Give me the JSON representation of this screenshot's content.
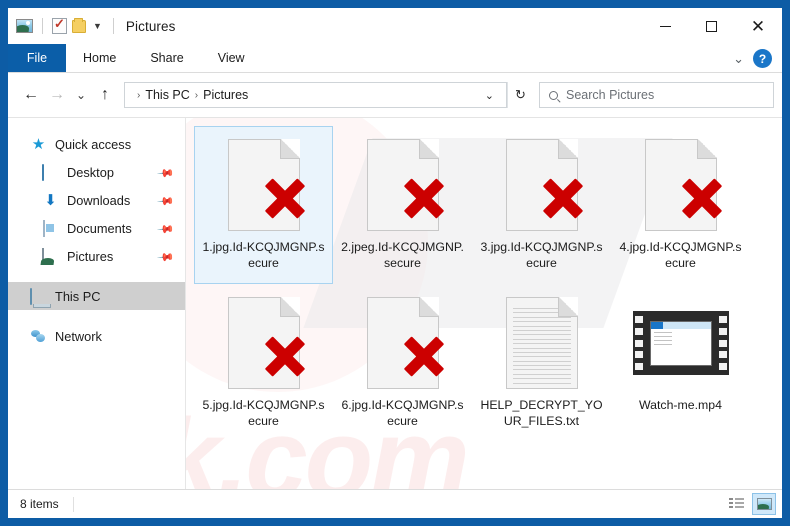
{
  "window": {
    "title": "Pictures",
    "quick_access_icons": [
      "picture-icon",
      "properties-icon",
      "folder-icon",
      "customize-caret-icon"
    ],
    "controls": {
      "minimize": "–",
      "maximize": "□",
      "close": "✕"
    }
  },
  "ribbon": {
    "file_tab": "File",
    "tabs": [
      "Home",
      "Share",
      "View"
    ],
    "expand_caret": "⌄",
    "help": "?"
  },
  "address": {
    "back": "←",
    "forward": "→",
    "recent_caret": "⌄",
    "up": "↑",
    "crumbs": [
      "This PC",
      "Pictures"
    ],
    "separator": "›",
    "dropdown_caret": "⌄",
    "refresh": "↻"
  },
  "search": {
    "placeholder": "Search Pictures"
  },
  "sidebar": {
    "items": [
      {
        "label": "Quick access",
        "icon": "star-icon",
        "pinned": false,
        "selected": false,
        "child": false
      },
      {
        "label": "Desktop",
        "icon": "desktop-icon",
        "pinned": true,
        "selected": false,
        "child": true
      },
      {
        "label": "Downloads",
        "icon": "downloads-icon",
        "pinned": true,
        "selected": false,
        "child": true
      },
      {
        "label": "Documents",
        "icon": "documents-icon",
        "pinned": true,
        "selected": false,
        "child": true
      },
      {
        "label": "Pictures",
        "icon": "pictures-icon",
        "pinned": true,
        "selected": false,
        "child": true
      },
      {
        "label": "This PC",
        "icon": "this-pc-icon",
        "pinned": false,
        "selected": true,
        "child": false
      },
      {
        "label": "Network",
        "icon": "network-icon",
        "pinned": false,
        "selected": false,
        "child": false
      }
    ],
    "pin_glyph": "📌"
  },
  "files": [
    {
      "name": "1.jpg.Id-KCQJMGNP.secure",
      "type": "encrypted",
      "selected": true
    },
    {
      "name": "2.jpeg.Id-KCQJMGNP.secure",
      "type": "encrypted",
      "selected": false
    },
    {
      "name": "3.jpg.Id-KCQJMGNP.secure",
      "type": "encrypted",
      "selected": false
    },
    {
      "name": "4.jpg.Id-KCQJMGNP.secure",
      "type": "encrypted",
      "selected": false
    },
    {
      "name": "5.jpg.Id-KCQJMGNP.secure",
      "type": "encrypted",
      "selected": false
    },
    {
      "name": "6.jpg.Id-KCQJMGNP.secure",
      "type": "encrypted",
      "selected": false
    },
    {
      "name": "HELP_DECRYPT_YOUR_FILES.txt",
      "type": "text",
      "selected": false
    },
    {
      "name": "Watch-me.mp4",
      "type": "video",
      "selected": false
    }
  ],
  "status": {
    "item_count": "8 items",
    "views": [
      {
        "name": "details-view",
        "active": false
      },
      {
        "name": "large-icons-view",
        "active": true
      }
    ]
  },
  "watermark": {
    "text": "risk.com"
  },
  "colors": {
    "frame_blue": "#0d5ca5",
    "file_tab_blue": "#0b5ea8",
    "selection_blue": "#eaf4fc",
    "red_x": "#cc0000"
  }
}
